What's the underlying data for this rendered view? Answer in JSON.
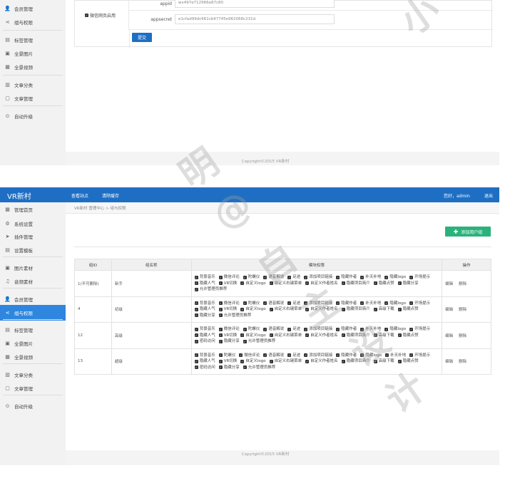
{
  "top": {
    "sidebar": [
      {
        "label": "会员管理",
        "icon": "users-icon"
      },
      {
        "label": "组与权限",
        "icon": "share-icon"
      },
      {
        "label": "标签管理",
        "icon": "tag-icon"
      },
      {
        "label": "全景图片",
        "icon": "image-icon"
      },
      {
        "label": "全景视频",
        "icon": "grid-icon"
      },
      {
        "label": "文章分类",
        "icon": "book-icon"
      },
      {
        "label": "文章管理",
        "icon": "document-icon"
      },
      {
        "label": "自动升级",
        "icon": "upgrade-icon"
      }
    ],
    "checkbox_label": "微信网页启用",
    "appid_label": "appid",
    "appid_value": "wx497e712966e87c80",
    "appsecret_label": "appsecret",
    "appsecret_value": "e1cfad99dc661cb47745e962068c231d",
    "submit_label": "提交",
    "footer": "Copyright©2015   VR新村"
  },
  "bottom": {
    "logo": "VR新村",
    "nav": [
      "查看站点",
      "清除缓存"
    ],
    "greeting": "您好，admin",
    "logout": "退出",
    "sidebar": [
      {
        "label": "管理首页",
        "icon": "home-icon"
      },
      {
        "label": "系统设置",
        "icon": "gear-icon"
      },
      {
        "label": "插件管理",
        "icon": "send-icon"
      },
      {
        "label": "设置模板",
        "icon": "template-icon"
      },
      {
        "label": "图片素材",
        "icon": "picture-icon"
      },
      {
        "label": "音频素材",
        "icon": "audio-icon"
      },
      {
        "label": "会员管理",
        "icon": "users-icon"
      },
      {
        "label": "组与权限",
        "icon": "share-icon"
      },
      {
        "label": "标签管理",
        "icon": "tag-icon"
      },
      {
        "label": "全景图片",
        "icon": "image-icon"
      },
      {
        "label": "全景视频",
        "icon": "grid-icon"
      },
      {
        "label": "文章分类",
        "icon": "book-icon"
      },
      {
        "label": "文章管理",
        "icon": "document-icon"
      },
      {
        "label": "自动升级",
        "icon": "upgrade-icon"
      }
    ],
    "active_item": "组与权限",
    "breadcrumb": "VR新村 管理中心   >   组与权限",
    "add_button": "添加用户组",
    "headers": [
      "组ID",
      "组名称",
      "模块权限",
      "操作"
    ],
    "rows": [
      {
        "id": "1(不可删除)",
        "name": "新手",
        "perms": [
          "背景音乐",
          "微信评论",
          "陀螺仪",
          "语音解说",
          "足迹",
          "添加项目链接",
          "隐藏作者",
          "补天补地",
          "隐藏logo",
          "开场提示",
          "隐藏人气",
          "VR切换",
          "自定义logo",
          "自定义右键菜单",
          "自定义作者姓名",
          "隐藏项目简介",
          "隐藏点赞",
          "隐藏分享",
          "允许管理员推荐"
        ],
        "ops": [
          "编辑",
          "删除"
        ]
      },
      {
        "id": "4",
        "name": "初级",
        "perms": [
          "背景音乐",
          "微信评论",
          "陀螺仪",
          "语音解说",
          "足迹",
          "添加项目链接",
          "隐藏作者",
          "补天补地",
          "隐藏logo",
          "开场提示",
          "隐藏人气",
          "VR切换",
          "自定义logo",
          "自定义右键菜单",
          "自定义作者姓名",
          "隐藏项目简介",
          "高级下载",
          "隐藏点赞",
          "隐藏分享",
          "允许管理员推荐"
        ],
        "ops": [
          "编辑",
          "删除"
        ]
      },
      {
        "id": "12",
        "name": "高级",
        "perms": [
          "背景音乐",
          "微信评论",
          "陀螺仪",
          "语音解说",
          "足迹",
          "添加项目链接",
          "隐藏作者",
          "补天补地",
          "隐藏logo",
          "开场提示",
          "隐藏人气",
          "VR切换",
          "自定义logo",
          "自定义右键菜单",
          "自定义作者姓名",
          "隐藏项目简介",
          "高级下载",
          "隐藏点赞",
          "密码访问",
          "隐藏分享",
          "允许管理员推荐"
        ],
        "ops": [
          "编辑",
          "删除"
        ]
      },
      {
        "id": "13",
        "name": "超级",
        "perms": [
          "背景音乐",
          "陀螺仪",
          "微信评论",
          "语音解说",
          "足迹",
          "添加项目链接",
          "隐藏作者",
          "隐藏logo",
          "补天补地",
          "开场提示",
          "隐藏人气",
          "VR切换",
          "自定义logo",
          "自定义右键菜单",
          "自定义作者姓名",
          "隐藏项目简介",
          "高级下载",
          "隐藏点赞",
          "密码访问",
          "隐藏分享",
          "允许管理员推荐"
        ],
        "ops": [
          "编辑",
          "删除"
        ]
      }
    ],
    "footer": "Copyright©2015   VR新村"
  },
  "watermark": [
    "小",
    "明",
    "@",
    "自",
    "主",
    "设",
    "计"
  ],
  "colors": {
    "primary": "#1e6fc4",
    "green": "#2ab27b",
    "sidebar": "#f2f2f2",
    "active": "#2e86de"
  }
}
